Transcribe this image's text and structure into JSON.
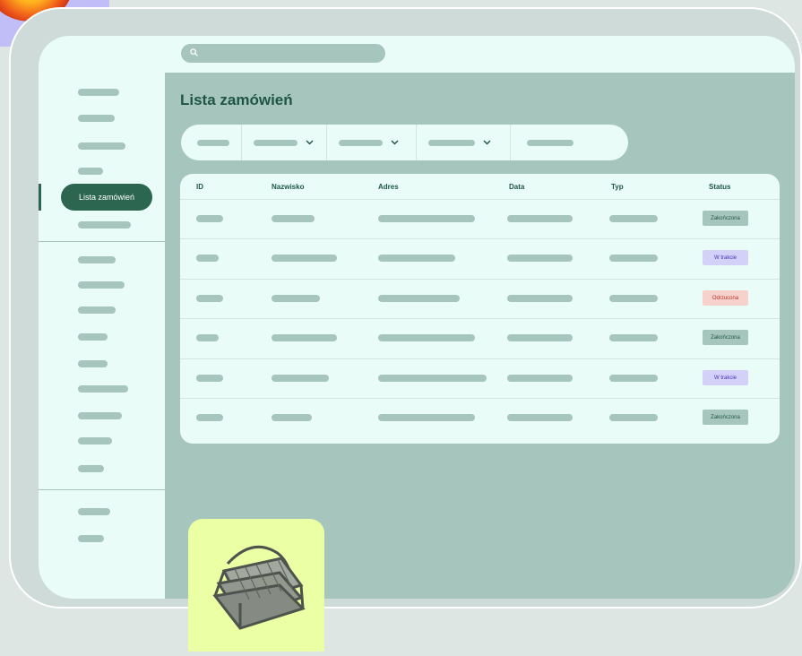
{
  "search": {
    "placeholder": ""
  },
  "sidebar": {
    "active_label": "Lista zamówień"
  },
  "page_title": "Lista zamówień",
  "table": {
    "columns": [
      "ID",
      "Nazwisko",
      "Adres",
      "Data",
      "Typ",
      "Status"
    ],
    "rows": [
      {
        "status": "Zakończona",
        "kind": "done"
      },
      {
        "status": "W trakcie",
        "kind": "progress"
      },
      {
        "status": "Odrzucona",
        "kind": "rejected"
      },
      {
        "status": "Zakończona",
        "kind": "done"
      },
      {
        "status": "W trakcie",
        "kind": "progress"
      },
      {
        "status": "Zakończona",
        "kind": "done"
      }
    ]
  },
  "icons": {
    "search": "search-icon",
    "chevron": "chevron-down-icon",
    "basket": "basket-icon",
    "orb": "orb-icon"
  },
  "colors": {
    "primary": "#2c6650",
    "panel": "#e9fcf7",
    "background": "#a6c5bd",
    "status_done": "#a6c5bd",
    "status_in_progress": "#d3d1f8",
    "status_rejected": "#f7d2cc"
  }
}
